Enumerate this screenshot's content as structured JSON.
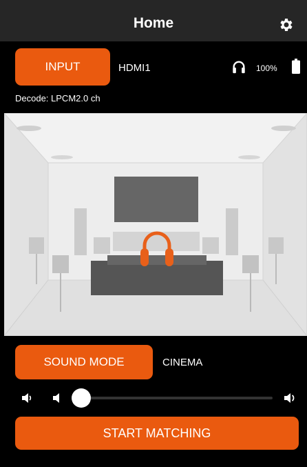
{
  "header": {
    "title": "Home"
  },
  "input": {
    "button_label": "INPUT",
    "value": "HDMI1"
  },
  "status": {
    "battery_text": "100%"
  },
  "decode": {
    "text": "Decode: LPCM2.0 ch"
  },
  "sound_mode": {
    "button_label": "SOUND MODE",
    "value": "CINEMA"
  },
  "volume": {
    "level": 0
  },
  "start": {
    "button_label": "START MATCHING"
  },
  "colors": {
    "accent": "#ea5a0f",
    "header_bg": "#262626",
    "background": "#000000",
    "room_bg": "#e9e9e9"
  },
  "icons": [
    "gear-icon",
    "headphones-icon",
    "battery-icon",
    "volume-mute-icon",
    "volume-down-icon",
    "volume-up-icon"
  ]
}
